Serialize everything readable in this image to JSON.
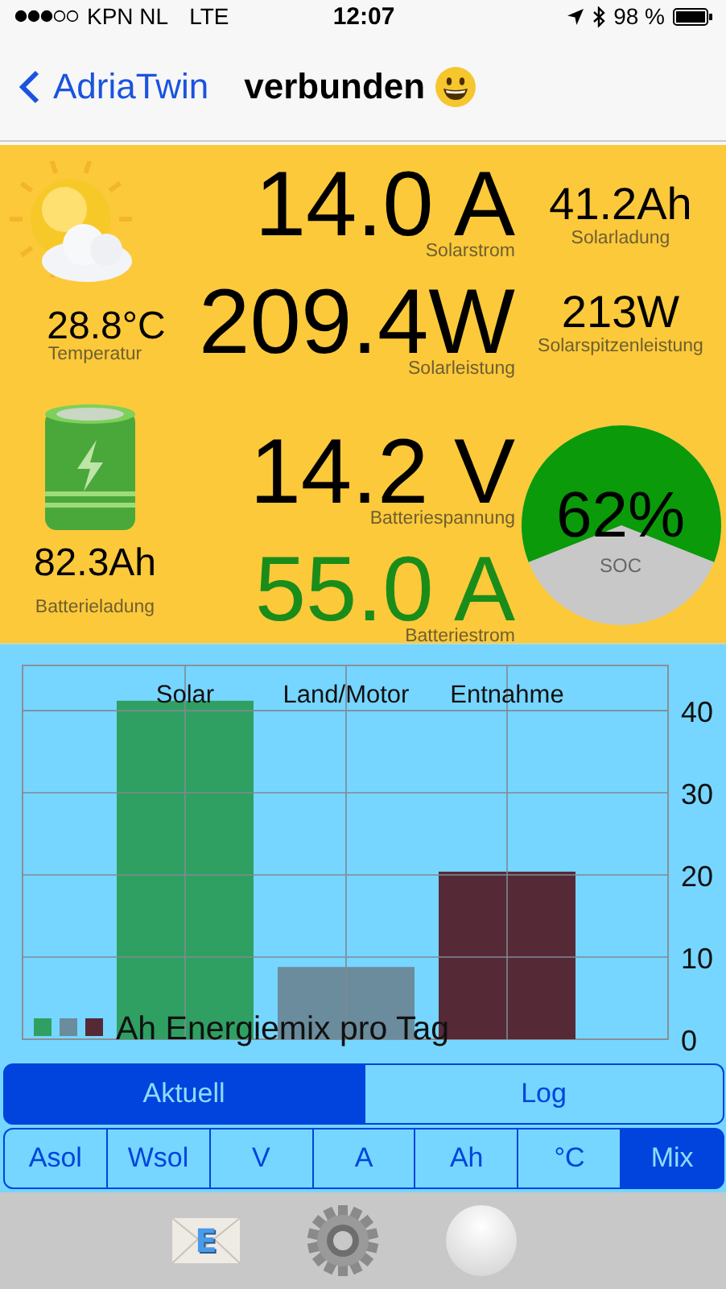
{
  "status_bar": {
    "carrier": "KPN NL",
    "network": "LTE",
    "time": "12:07",
    "battery": "98 %"
  },
  "nav": {
    "back": "AdriaTwin",
    "title": "verbunden"
  },
  "solar": {
    "temperature": {
      "value": "28.8°C",
      "label": "Temperatur"
    },
    "current": {
      "value": "14.0 A",
      "label": "Solarstrom"
    },
    "power": {
      "value": "209.4W",
      "label": "Solarleistung"
    },
    "charge": {
      "value": "41.2Ah",
      "label": "Solarladung"
    },
    "peak": {
      "value": "213W",
      "label": "Solarspitzenleistung"
    }
  },
  "battery": {
    "charge": {
      "value": "82.3Ah",
      "label": "Batterieladung"
    },
    "voltage": {
      "value": "14.2 V",
      "label": "Batteriespannung"
    },
    "current": {
      "value": "55.0 A",
      "label": "Batteriestrom",
      "color": "#1a8c1a"
    },
    "soc": {
      "value": "62%",
      "label": "SOC"
    }
  },
  "chart": {
    "chart_data": {
      "type": "bar",
      "title": "Ah Energiemix pro Tag",
      "categories": [
        "Solar",
        "Land/Motor",
        "Entnahme"
      ],
      "series": [
        {
          "color": "#2fa062",
          "values": [
            41.2,
            null,
            null
          ]
        },
        {
          "color": "#6a8c9c",
          "values": [
            null,
            8.8,
            null
          ]
        },
        {
          "color": "#552a36",
          "values": [
            null,
            null,
            20.4
          ]
        }
      ],
      "ylim": [
        0,
        45.5
      ],
      "yticks": [
        0,
        10,
        20,
        30,
        40
      ],
      "grid": true
    }
  },
  "view_tabs": [
    {
      "label": "Aktuell",
      "selected": true
    },
    {
      "label": "Log",
      "selected": false
    }
  ],
  "chart_tabs": [
    {
      "label": "Asol",
      "selected": false
    },
    {
      "label": "Wsol",
      "selected": false
    },
    {
      "label": "V",
      "selected": false
    },
    {
      "label": "A",
      "selected": false
    },
    {
      "label": "Ah",
      "selected": false
    },
    {
      "label": "°C",
      "selected": false
    },
    {
      "label": "Mix",
      "selected": true
    }
  ],
  "toolbar": [
    {
      "kind": "mail",
      "label": "E"
    },
    {
      "kind": "settings"
    },
    {
      "kind": "record"
    }
  ]
}
